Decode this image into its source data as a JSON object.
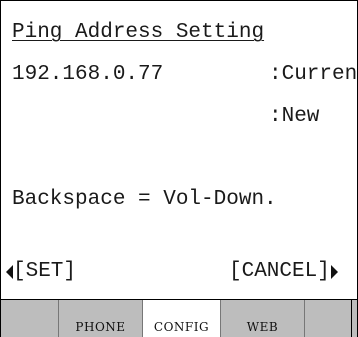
{
  "screen": {
    "title": "Ping Address Setting",
    "address_value": "192.168.0.77",
    "current_label": ":Current",
    "new_label": ":New",
    "hint": "Backspace = Vol-Down."
  },
  "softkeys": {
    "left_label": "[SET]",
    "right_label": "[CANCEL]"
  },
  "tabs": [
    {
      "label": ""
    },
    {
      "label": "PHONE"
    },
    {
      "label": "CONFIG",
      "active": true
    },
    {
      "label": "WEB"
    },
    {
      "label": ""
    },
    {
      "label": ""
    }
  ],
  "colors": {
    "tab_background": "#bdbdbd",
    "active_tab_background": "#ffffff",
    "text": "#1a1a1a"
  }
}
